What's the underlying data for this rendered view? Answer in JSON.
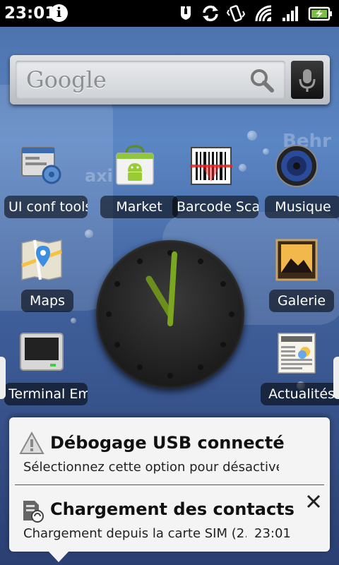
{
  "status_bar": {
    "time": "23:01",
    "icons": [
      "info-icon",
      "usb-debug-icon",
      "sync-icon",
      "vibrate-icon",
      "wifi-icon",
      "signal-icon",
      "battery-charging-icon"
    ]
  },
  "search_widget": {
    "logo": "Google"
  },
  "apps": [
    {
      "label": "UI conf tools",
      "icon": "ui-conf-icon"
    },
    {
      "label": "Market",
      "icon": "market-icon"
    },
    {
      "label": "Barcode Scanner",
      "icon": "barcode-icon"
    },
    {
      "label": "Musique",
      "icon": "music-icon"
    },
    {
      "label": "Maps",
      "icon": "maps-icon"
    },
    {
      "label": "Galerie",
      "icon": "gallery-icon"
    },
    {
      "label": "Terminal Emulator",
      "icon": "terminal-icon"
    },
    {
      "label": "Actualités",
      "icon": "news-icon"
    }
  ],
  "notifications": [
    {
      "title": "Débogage USB connecté",
      "text": "Sélectionnez cette option pour désactiver le débogage USB",
      "icon": "warning-icon"
    },
    {
      "title": "Chargement des contacts",
      "text": "Chargement depuis la carte SIM (2...",
      "time": "23:01",
      "icon": "sim-contacts-icon"
    }
  ],
  "colors": {
    "accent": "#6aa51c",
    "panel": "#f4f4f4"
  }
}
